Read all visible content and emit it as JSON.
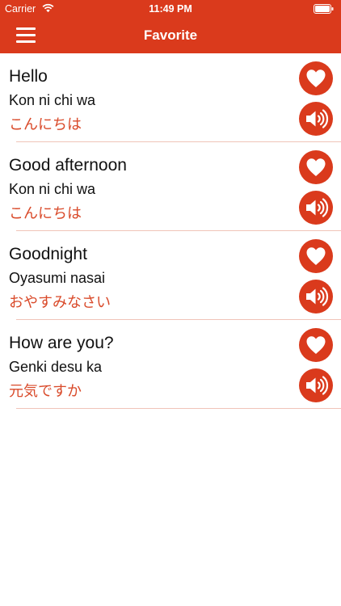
{
  "status_bar": {
    "carrier": "Carrier",
    "time": "11:49 PM"
  },
  "nav": {
    "title": "Favorite"
  },
  "colors": {
    "accent": "#da3a1c",
    "japanese_text": "#d94a2a"
  },
  "phrases": [
    {
      "english": "Hello",
      "romaji": "Kon ni chi wa",
      "japanese": "こんにちは"
    },
    {
      "english": "Good afternoon",
      "romaji": "Kon ni chi wa",
      "japanese": "こんにちは"
    },
    {
      "english": "Goodnight",
      "romaji": "Oyasumi nasai",
      "japanese": "おやすみなさい"
    },
    {
      "english": "How are you?",
      "romaji": "Genki desu ka",
      "japanese": "元気ですか"
    }
  ]
}
